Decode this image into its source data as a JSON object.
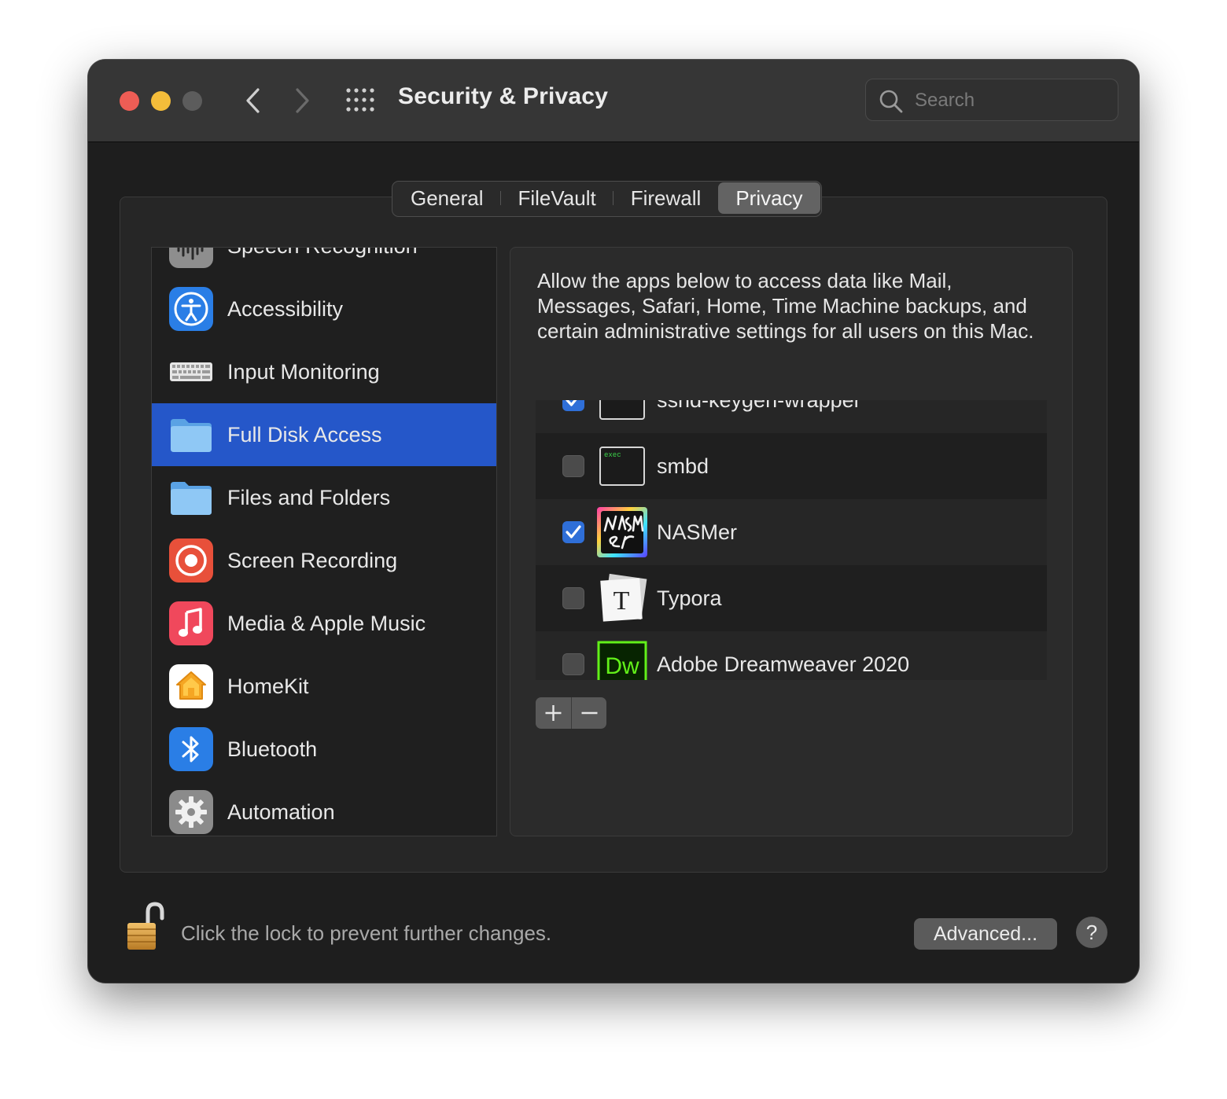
{
  "window": {
    "title": "Security & Privacy",
    "search_placeholder": "Search"
  },
  "tabs": [
    {
      "label": "General",
      "active": false
    },
    {
      "label": "FileVault",
      "active": false
    },
    {
      "label": "Firewall",
      "active": false
    },
    {
      "label": "Privacy",
      "active": true
    }
  ],
  "sidebar": {
    "items": [
      {
        "label": "Speech Recognition",
        "icon": "waveform-icon"
      },
      {
        "label": "Accessibility",
        "icon": "accessibility-icon"
      },
      {
        "label": "Input Monitoring",
        "icon": "keyboard-icon"
      },
      {
        "label": "Full Disk Access",
        "icon": "folder-icon",
        "selected": true
      },
      {
        "label": "Files and Folders",
        "icon": "folder-icon"
      },
      {
        "label": "Screen Recording",
        "icon": "screen-recording-icon"
      },
      {
        "label": "Media & Apple Music",
        "icon": "music-note-icon"
      },
      {
        "label": "HomeKit",
        "icon": "home-icon"
      },
      {
        "label": "Bluetooth",
        "icon": "bluetooth-icon"
      },
      {
        "label": "Automation",
        "icon": "gear-icon"
      }
    ]
  },
  "content": {
    "description": "Allow the apps below to access data like Mail, Messages, Safari, Home, Time Machine backups, and certain administrative settings for all users on this Mac.",
    "apps": [
      {
        "name": "sshd-keygen-wrapper",
        "checked": true,
        "icon": "terminal-icon"
      },
      {
        "name": "smbd",
        "checked": false,
        "icon": "exec-terminal-icon",
        "icon_text": "exec"
      },
      {
        "name": "NASMer",
        "checked": true,
        "icon": "nasmer-app-icon"
      },
      {
        "name": "Typora",
        "checked": false,
        "icon": "typora-app-icon",
        "icon_text": "T"
      },
      {
        "name": "Adobe Dreamweaver 2020",
        "checked": false,
        "icon": "dreamweaver-app-icon",
        "icon_text": "Dw"
      }
    ]
  },
  "footer": {
    "lock_text": "Click the lock to prevent further changes.",
    "advanced_label": "Advanced...",
    "help_label": "?"
  },
  "colors": {
    "accent": "#2557c9",
    "checkbox_on": "#2f6fd8",
    "close": "#ee5d55",
    "minimize": "#f4bd3a"
  }
}
